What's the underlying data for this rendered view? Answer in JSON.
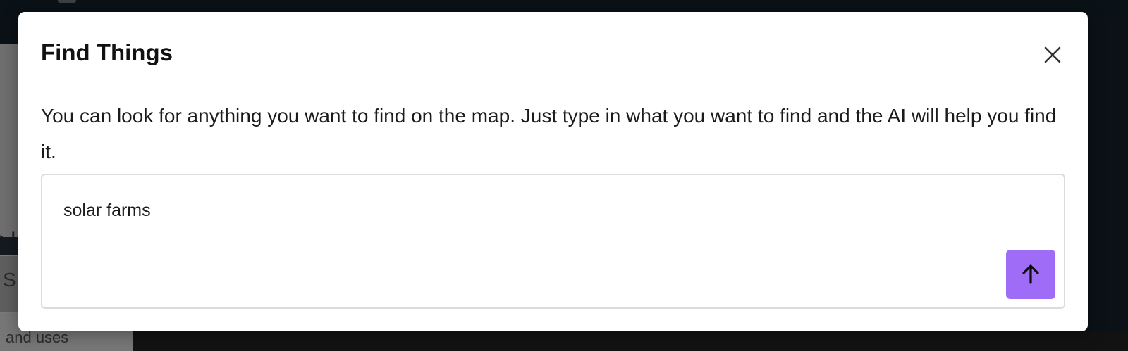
{
  "background": {
    "side_heading_fragment": "e L",
    "search_fragment": "S",
    "bottom_text_fragment": "and uses"
  },
  "modal": {
    "title": "Find Things",
    "description": "You can look for anything you want to find on the map. Just type in what you want to find and the AI will help you find it.",
    "query_value": "solar farms",
    "close_icon": "close-icon",
    "submit_icon": "arrow-up-icon",
    "accent_color": "#9f6cf8"
  }
}
